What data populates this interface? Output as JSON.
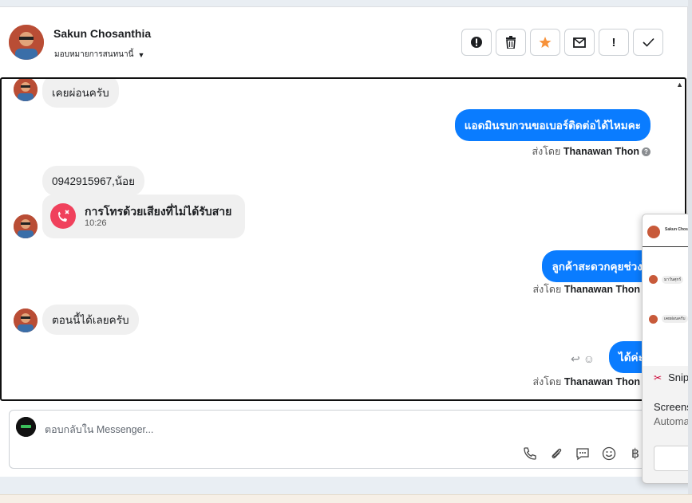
{
  "header": {
    "contact_name": "Sakun Chosanthia",
    "assign_label": "มอบหมายการสนทนานี้",
    "actions": [
      {
        "name": "spam-button",
        "icon": "exclamation-circle-icon",
        "glyph": "!"
      },
      {
        "name": "delete-button",
        "icon": "trash-icon",
        "glyph": "🗑"
      },
      {
        "name": "star-button",
        "icon": "star-icon",
        "glyph": "★"
      },
      {
        "name": "mark-unread-button",
        "icon": "envelope-icon",
        "glyph": "✉"
      },
      {
        "name": "follow-up-button",
        "icon": "exclamation-icon",
        "glyph": "!"
      },
      {
        "name": "mark-done-button",
        "icon": "check-icon",
        "glyph": "✓"
      }
    ]
  },
  "thread": {
    "messages": [
      {
        "dir": "in",
        "text": "เคยผ่อนครับ"
      },
      {
        "dir": "out",
        "text": "แอดมินรบกวนขอเบอร์ติดต่อได้ไหมคะ",
        "sent_by_prefix": "ส่งโดย",
        "sent_by": "Thanawan Thon"
      },
      {
        "dir": "in",
        "text": "0942915967,น้อย"
      },
      {
        "dir": "in-call",
        "title": "การโทรด้วยเสียงที่ไม่ได้รับสาย",
        "time": "10:26"
      },
      {
        "dir": "out",
        "text": "ลูกค้าสะดวกคุยช่วงไหนคะ",
        "sent_by_prefix": "ส่งโดย",
        "sent_by": "Thanawan Thon"
      },
      {
        "dir": "in",
        "text": "ตอนนี้ได้เลยครับ"
      },
      {
        "dir": "out",
        "text": "ได้ค่ะ",
        "sent_by_prefix": "ส่งโดย",
        "sent_by": "Thanawan Thon"
      }
    ]
  },
  "composer": {
    "placeholder": "ตอบกลับใน Messenger...",
    "tools": [
      {
        "name": "call-icon",
        "glyph": "✆"
      },
      {
        "name": "attach-icon",
        "glyph": "📎"
      },
      {
        "name": "saved-reply-icon",
        "glyph": "💬"
      },
      {
        "name": "emoji-icon",
        "glyph": "☺"
      },
      {
        "name": "baht-icon",
        "glyph": "฿"
      }
    ]
  },
  "snip_popup": {
    "preview_name": "Sakun Chos",
    "preview_bubbles": [
      "มาวันศุกร์",
      "เคยผ่อนครับ"
    ],
    "app_name": "Snip",
    "title": "Screens",
    "subtitle": "Automa"
  },
  "colors": {
    "accent": "#0a7cff",
    "missed_call": "#f0415c",
    "star": "#f7923a"
  }
}
